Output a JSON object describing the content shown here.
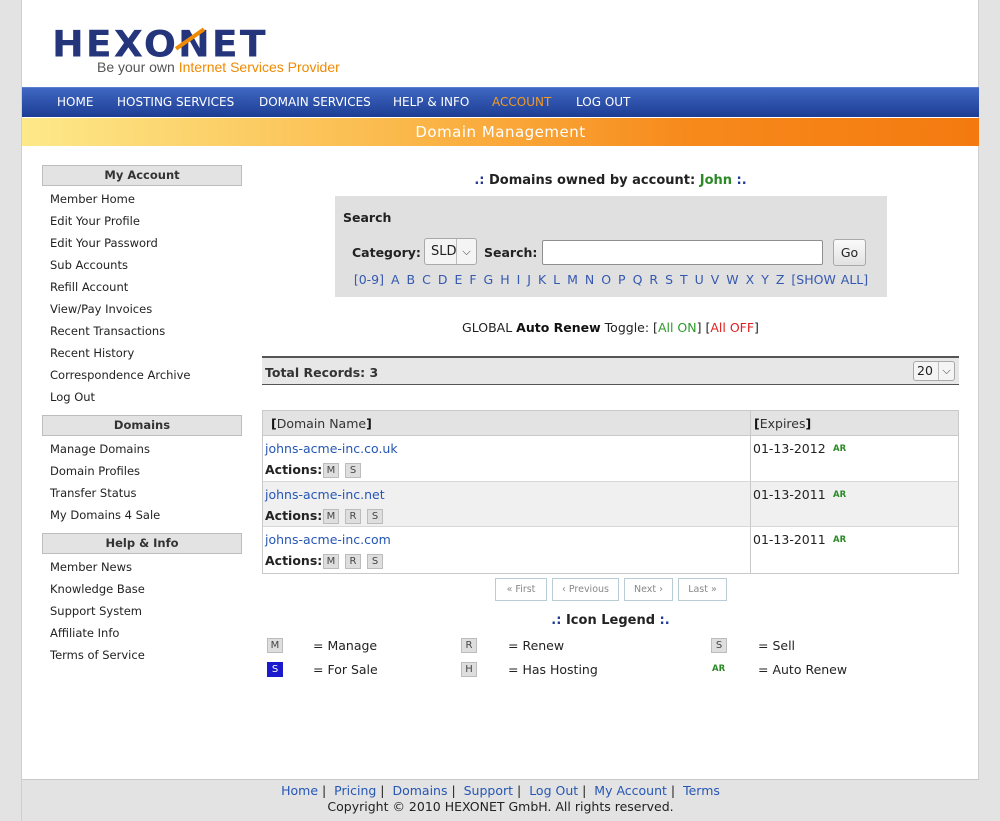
{
  "logo": {
    "wordmark": "HEXONET",
    "tagline_prefix": "Be your own ",
    "tagline_highlight": "Internet Services Provider"
  },
  "nav": {
    "items": [
      "HOME",
      "HOSTING SERVICES",
      "DOMAIN SERVICES",
      "HELP & INFO",
      "ACCOUNT",
      "LOG OUT"
    ],
    "active": "ACCOUNT"
  },
  "subbar": {
    "title": "Domain Management"
  },
  "sidebar": {
    "my_account": {
      "heading": "My Account",
      "items": [
        "Member Home",
        "Edit Your Profile",
        "Edit Your Password",
        "Sub Accounts",
        "Refill Account",
        "View/Pay Invoices",
        "Recent Transactions",
        "Recent History",
        "Correspondence Archive",
        "Log Out"
      ]
    },
    "domains": {
      "heading": "Domains",
      "items": [
        "Manage Domains",
        "Domain Profiles",
        "Transfer Status",
        "My Domains 4 Sale"
      ]
    },
    "help": {
      "heading": "Help & Info",
      "items": [
        "Member News",
        "Knowledge Base",
        "Support System",
        "Affiliate Info",
        "Terms of Service"
      ]
    }
  },
  "owned": {
    "prefix": ".:",
    "label": "Domains owned by account:",
    "account": "John",
    "suffix": ":."
  },
  "search": {
    "title": "Search",
    "category_label": "Category:",
    "category_value": "SLD",
    "search_label": "Search:",
    "search_value": "",
    "go_label": "Go",
    "alpha": [
      "[0-9]",
      "A",
      "B",
      "C",
      "D",
      "E",
      "F",
      "G",
      "H",
      "I",
      "J",
      "K",
      "L",
      "M",
      "N",
      "O",
      "P",
      "Q",
      "R",
      "S",
      "T",
      "U",
      "V",
      "W",
      "X",
      "Y",
      "Z",
      "[SHOW ALL]"
    ]
  },
  "global_toggle": {
    "prefix": "GLOBAL",
    "bold": "Auto Renew",
    "suffix": "Toggle:",
    "on": "All ON",
    "off": "All OFF"
  },
  "records": {
    "label": "Total Records: 3",
    "per_page": "20"
  },
  "table": {
    "col_domain": "Domain Name",
    "col_expires": "Expires",
    "actions_label": "Actions:",
    "rows": [
      {
        "domain": "johns-acme-inc.co.uk",
        "actions": [
          "M",
          "S"
        ],
        "expires": "01-13-2012",
        "badge": "AR"
      },
      {
        "domain": "johns-acme-inc.net",
        "actions": [
          "M",
          "R",
          "S"
        ],
        "expires": "01-13-2011",
        "badge": "AR"
      },
      {
        "domain": "johns-acme-inc.com",
        "actions": [
          "M",
          "R",
          "S"
        ],
        "expires": "01-13-2011",
        "badge": "AR"
      }
    ]
  },
  "pager": {
    "first": "« First",
    "previous": "‹ Previous",
    "next": "Next ›",
    "last": "Last »"
  },
  "legend": {
    "title": "Icon Legend",
    "title_prefix": ".:",
    "title_suffix": ":.",
    "items": [
      {
        "icon": "M",
        "text": "= Manage"
      },
      {
        "icon": "R",
        "text": "= Renew"
      },
      {
        "icon": "S",
        "text": "= Sell"
      },
      {
        "icon": "S",
        "text": "= For Sale"
      },
      {
        "icon": "H",
        "text": "= Has Hosting"
      },
      {
        "icon": "AR",
        "text": "= Auto Renew"
      }
    ]
  },
  "footer": {
    "links": [
      "Home",
      "Pricing",
      "Domains",
      "Support",
      "Log Out",
      "My Account",
      "Terms"
    ],
    "copyright": "Copyright © 2010 HEXONET GmbH. All rights reserved."
  },
  "colors": {
    "nav_blue": "#2a4fad",
    "accent_orange": "#f59a22",
    "link_blue": "#2556b4",
    "green": "#2c8a26",
    "red": "#e02020"
  }
}
